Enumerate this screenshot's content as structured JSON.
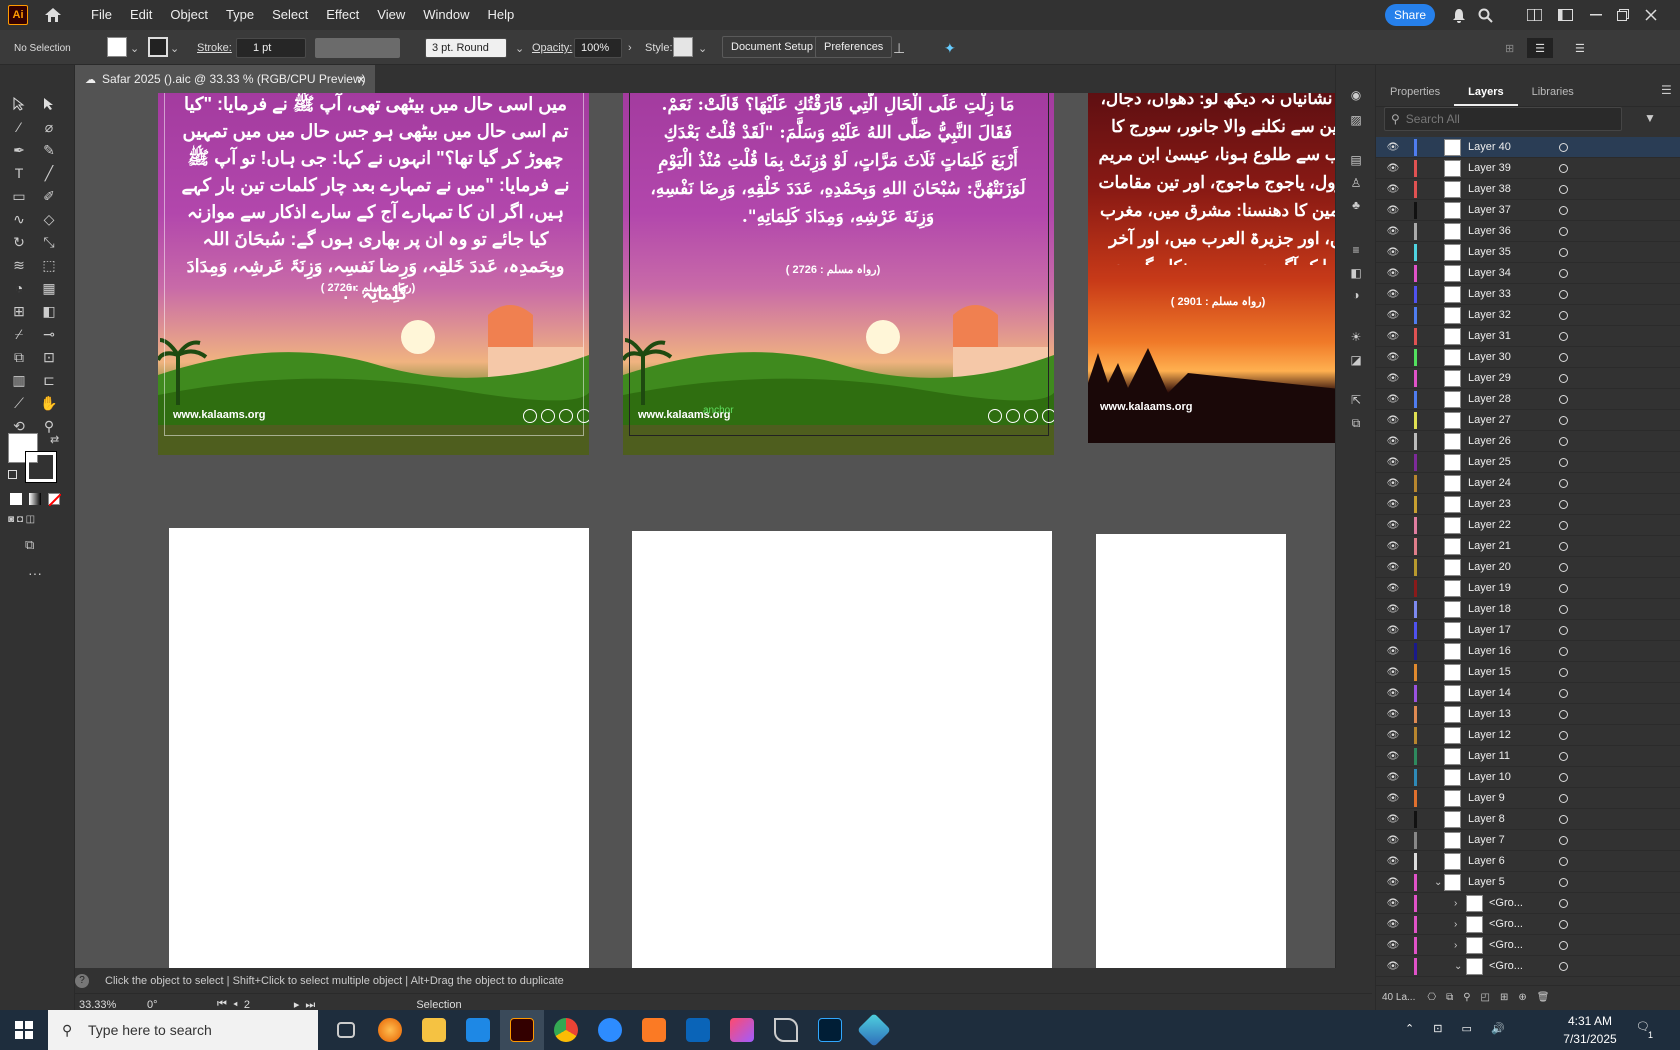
{
  "app": {
    "logo": "Ai",
    "home_icon": "home-icon"
  },
  "menu": [
    "File",
    "Edit",
    "Object",
    "Type",
    "Select",
    "Effect",
    "View",
    "Window",
    "Help"
  ],
  "share_label": "Share",
  "control": {
    "selection": "No Selection",
    "stroke_label": "Stroke:",
    "stroke_value": "1 pt",
    "brush": "3 pt. Round",
    "opacity_label": "Opacity:",
    "opacity_value": "100%",
    "style_label": "Style:",
    "doc_setup": "Document Setup",
    "preferences": "Preferences"
  },
  "doc_tab": {
    "title": "Safar 2025 ().aic @ 33.33 % (RGB/CPU Preview)",
    "close": "×"
  },
  "artboards": {
    "ab1_text": "میں اسی حال میں بیٹھی تھی، آپ ﷺ نے فرمایا: \"کیا تم اسی حال میں بیٹھی ہو جس حال میں میں تمہیں چھوڑ کر گیا تھا؟\" انہوں نے کہا: جی ہاں! تو آپ ﷺ نے فرمایا: \"میں نے تمہارے بعد چار کلمات تین بار کہے ہیں، اگر ان کا تمہارے آج کے سارے اذکار سے موازنہ کیا جائے تو وہ ان پر بھاری ہوں گے: سُبحَانَ اللہ وبِحَمدِہ، عَددَ خَلقِہ، وَرِضا نَفسِہ، وَزِنَۃَ عَرشِہ، وَمِدَادَ کَلِماتِہ \".",
    "ab1_ref": "(رواہ مسلم : 2726 )",
    "ab2_text": "مَا زِلْتِ عَلَى الْحَالِ الَّتِي فَارَقْتُكِ عَلَيْهَا؟ قَالَتْ: نَعَمْ. فَقَالَ النَّبِيُّ صَلَّى اللهُ عَلَيْهِ وَسَلَّمَ: \"لَقَدْ قُلْتُ بَعْدَكِ أَرْبَعَ كَلِمَاتٍ ثَلَاثَ مَرَّاتٍ، لَوْ وُزِنَتْ بِمَا قُلْتِ مُنْذُ الْيَوْمِ لَوَزَنَتْهُنَّ: سُبْحَانَ اللهِ وَبِحَمْدِهِ، عَدَدَ خَلْقِهِ، وَرِضَا نَفْسِهِ، وَزِنَةَ عَرْشِهِ، وَمِدَادَ كَلِمَاتِهِ\".",
    "ab2_ref": "(رواہ مسلم : 2726 )",
    "ab2_anchor": "anchor",
    "ab3_text": "دس نشانیاں نہ دیکھ لو: دھواں، دجال، زمین سے نکلنے والا جانور، سورج کا مغرب سے طلوع ہونا، عیسیٰ ابن مریم کا نزول، یاجوج ماجوج، اور تین مقامات پر زمین کا دھنسنا: مشرق میں، مغرب میں، اور جزیرۃ العرب میں، اور آخر میں ایک آگ جو یمن سے نکلے گی جو لوگوں کو ان کے محشر کی طرف ہانکے گی-",
    "ab3_ref": "(رواہ مسلم : 2901 )",
    "site": "www.kalaams.org"
  },
  "panel": {
    "tabs": [
      "Properties",
      "Layers",
      "Libraries"
    ],
    "search_placeholder": "Search All",
    "layers": [
      {
        "name": "Layer 40",
        "color": "#4f7df0"
      },
      {
        "name": "Layer 39",
        "color": "#e05252"
      },
      {
        "name": "Layer 38",
        "color": "#e05252"
      },
      {
        "name": "Layer 37",
        "color": "#111111"
      },
      {
        "name": "Layer 36",
        "color": "#aaaaaa"
      },
      {
        "name": "Layer 35",
        "color": "#4fd3e0"
      },
      {
        "name": "Layer 34",
        "color": "#e052c8"
      },
      {
        "name": "Layer 33",
        "color": "#4f52f0"
      },
      {
        "name": "Layer 32",
        "color": "#4f7df0"
      },
      {
        "name": "Layer 31",
        "color": "#e05252"
      },
      {
        "name": "Layer 30",
        "color": "#52e05e"
      },
      {
        "name": "Layer 29",
        "color": "#e052c8"
      },
      {
        "name": "Layer 28",
        "color": "#4f7df0"
      },
      {
        "name": "Layer 27",
        "color": "#e0e052"
      },
      {
        "name": "Layer 26",
        "color": "#bbbbbb"
      },
      {
        "name": "Layer 25",
        "color": "#7d2a9a"
      },
      {
        "name": "Layer 24",
        "color": "#b8862e"
      },
      {
        "name": "Layer 23",
        "color": "#c8a030"
      },
      {
        "name": "Layer 22",
        "color": "#e07da0"
      },
      {
        "name": "Layer 21",
        "color": "#e07d8a"
      },
      {
        "name": "Layer 20",
        "color": "#b89a2e"
      },
      {
        "name": "Layer 19",
        "color": "#8a1a1a"
      },
      {
        "name": "Layer 18",
        "color": "#7d8af0"
      },
      {
        "name": "Layer 17",
        "color": "#4f52f0"
      },
      {
        "name": "Layer 16",
        "color": "#1a1a8a"
      },
      {
        "name": "Layer 15",
        "color": "#e08a2e"
      },
      {
        "name": "Layer 14",
        "color": "#9a52e0"
      },
      {
        "name": "Layer 13",
        "color": "#e08a52"
      },
      {
        "name": "Layer 12",
        "color": "#b8862e"
      },
      {
        "name": "Layer 11",
        "color": "#2e8a5e"
      },
      {
        "name": "Layer 10",
        "color": "#2e8ab8"
      },
      {
        "name": "Layer 9",
        "color": "#e0702e"
      },
      {
        "name": "Layer 8",
        "color": "#111111"
      },
      {
        "name": "Layer 7",
        "color": "#888888"
      },
      {
        "name": "Layer 6",
        "color": "#dddddd"
      },
      {
        "name": "Layer 5",
        "color": "#e052c8",
        "expanded": true
      },
      {
        "name": "<Gro...",
        "color": "#e052c8",
        "sub": true
      },
      {
        "name": "<Gro...",
        "color": "#e052c8",
        "sub": true
      },
      {
        "name": "<Gro...",
        "color": "#e052c8",
        "sub": true
      },
      {
        "name": "<Gro...",
        "color": "#e052c8",
        "sub": true,
        "open": true
      }
    ],
    "footer_count": "40 La..."
  },
  "hint": "Click the object to select  |  Shift+Click to select multiple object  |  Alt+Drag the object to duplicate",
  "status": {
    "zoom": "33.33%",
    "rotate": "0°",
    "page": "2",
    "tool": "Selection"
  },
  "taskbar": {
    "search": "Type here to search",
    "time": "4:31 AM",
    "date": "7/31/2025",
    "notif": "1"
  }
}
